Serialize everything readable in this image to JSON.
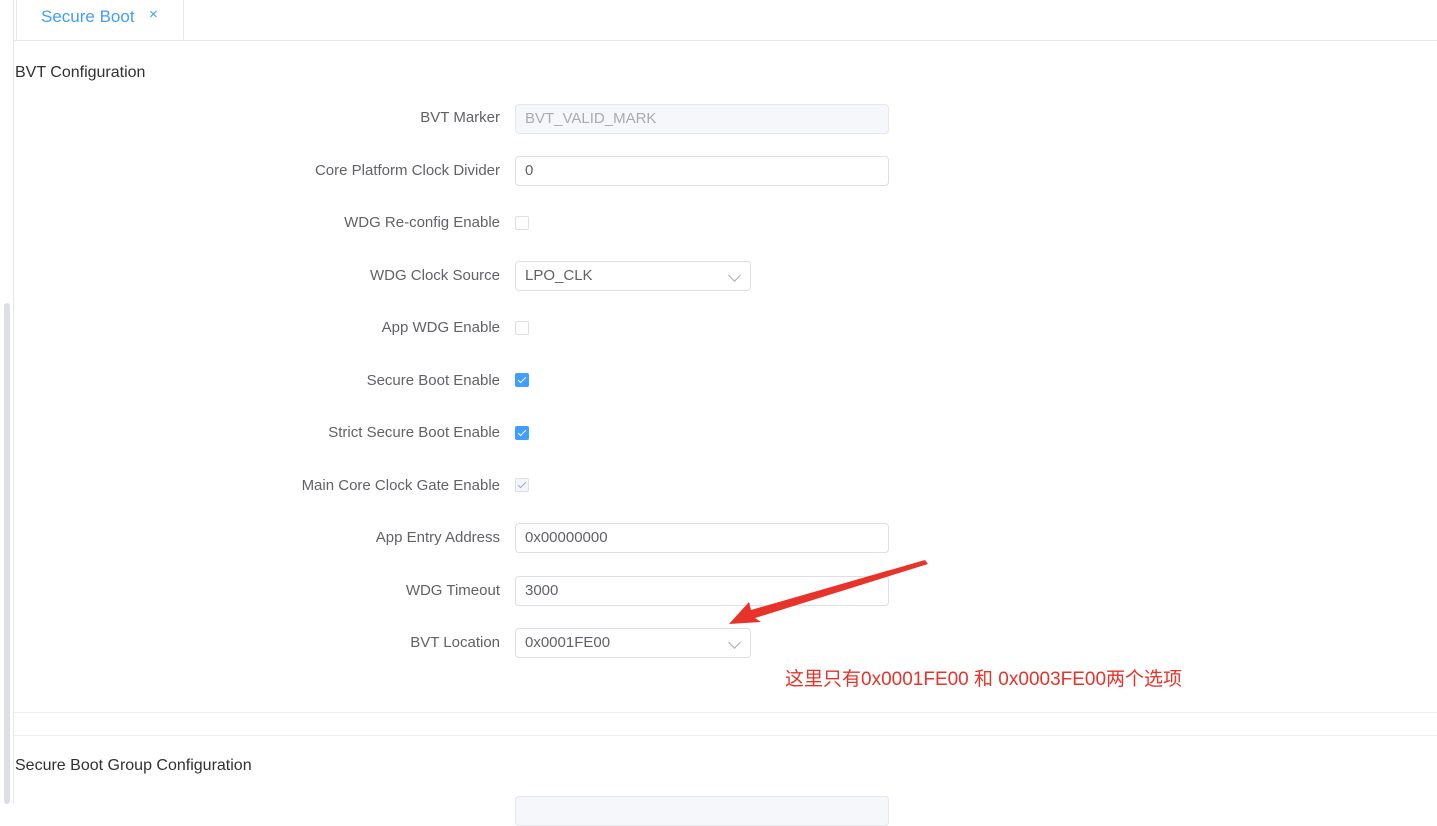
{
  "tab": {
    "label": "Secure Boot",
    "close_glyph": "×"
  },
  "bvt_section": {
    "title": "BVT Configuration",
    "fields": {
      "bvt_marker": {
        "label": "BVT Marker",
        "value": "BVT_VALID_MARK",
        "disabled": true
      },
      "core_platform_clock_divider": {
        "label": "Core Platform Clock Divider",
        "value": "0"
      },
      "wdg_reconfig_enable": {
        "label": "WDG Re-config Enable",
        "checked": false
      },
      "wdg_clock_source": {
        "label": "WDG Clock Source",
        "value": "LPO_CLK"
      },
      "app_wdg_enable": {
        "label": "App WDG Enable",
        "checked": false
      },
      "secure_boot_enable": {
        "label": "Secure Boot Enable",
        "checked": true
      },
      "strict_secure_boot_enable": {
        "label": "Strict Secure Boot Enable",
        "checked": true
      },
      "main_core_clock_gate_enable": {
        "label": "Main Core Clock Gate Enable",
        "checked": true,
        "disabled": true
      },
      "app_entry_address": {
        "label": "App Entry Address",
        "value": "0x00000000"
      },
      "wdg_timeout": {
        "label": "WDG Timeout",
        "value": "3000"
      },
      "bvt_location": {
        "label": "BVT Location",
        "value": "0x0001FE00"
      }
    }
  },
  "annotation": {
    "text": "这里只有0x0001FE00 和 0x0003FE00两个选项",
    "color": "#e8332a"
  },
  "group_section": {
    "title": "Secure Boot Group Configuration"
  },
  "colors": {
    "accent": "#409eff",
    "annotation": "#e8332a"
  }
}
